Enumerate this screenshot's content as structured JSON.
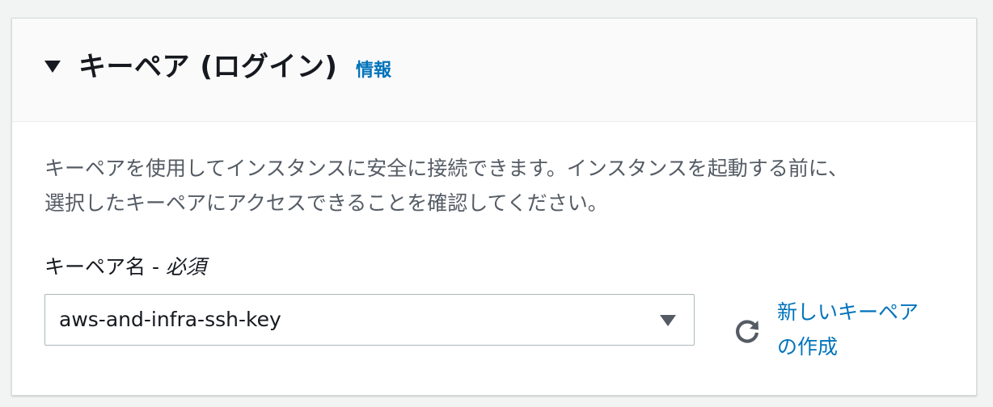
{
  "section": {
    "title": "キーペア (ログイン)",
    "info_link": "情報",
    "description_line1": "キーペアを使用してインスタンスに安全に接続できます。インスタンスを起動する前に、",
    "description_line2": "選択したキーペアにアクセスできることを確認してください。",
    "toggle_icon": "caret-down-icon"
  },
  "key_pair_field": {
    "label": "キーペア名 - ",
    "required_label": "必須",
    "selected_value": "aws-and-infra-ssh-key",
    "dropdown_icon": "caret-down-icon"
  },
  "actions": {
    "refresh_icon": "refresh-icon",
    "new_key_line1": "新しいキーペア",
    "new_key_line2": "の作成"
  },
  "colors": {
    "link": "#0073bb",
    "text": "#16191f",
    "muted_text": "#545b64",
    "header_bg": "#fafafa",
    "border": "#aab7b8"
  }
}
